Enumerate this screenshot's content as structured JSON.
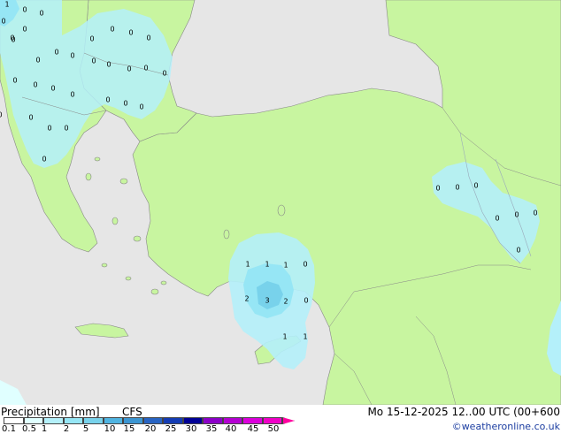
{
  "footer": {
    "title": "Precipitation [mm]",
    "model": "CFS",
    "datetime": "Mo 15-12-2025 12..00 UTC (00+600",
    "credit": "©weatheronline.co.uk"
  },
  "legend": {
    "ticks": [
      "0.1",
      "0.5",
      "1",
      "2",
      "5",
      "10",
      "15",
      "20",
      "25",
      "30",
      "35",
      "40",
      "45",
      "50"
    ],
    "colors": [
      "#ffffff",
      "#e0ffff",
      "#b4f0fa",
      "#96e6f5",
      "#78d2eb",
      "#50b4e1",
      "#3c96d2",
      "#2864c3",
      "#143cb4",
      "#000096",
      "#8c00c8",
      "#b400d2",
      "#dc00dc",
      "#f000c8",
      "#ff00a0"
    ]
  },
  "colors": {
    "sea": "#e6e6e6",
    "land": "#c8f5a0",
    "precip_light": "#b4f0fa",
    "precip_mid": "#96e6f5",
    "precip_dark": "#78d2eb"
  },
  "map_labels": [
    {
      "text": "1"
    },
    {
      "text": "0"
    },
    {
      "text": "0"
    },
    {
      "text": "0"
    },
    {
      "text": "0"
    },
    {
      "text": "0"
    },
    {
      "text": "0"
    },
    {
      "text": "0"
    },
    {
      "text": "0"
    },
    {
      "text": "0"
    },
    {
      "text": "0"
    },
    {
      "text": "0"
    },
    {
      "text": "0"
    },
    {
      "text": "0"
    },
    {
      "text": "0"
    },
    {
      "text": "0"
    },
    {
      "text": "0"
    },
    {
      "text": "0"
    },
    {
      "text": "0"
    },
    {
      "text": "0"
    },
    {
      "text": "0"
    },
    {
      "text": "0"
    },
    {
      "text": "0"
    },
    {
      "text": "0"
    },
    {
      "text": "0"
    },
    {
      "text": "0"
    },
    {
      "text": "0"
    },
    {
      "text": "0"
    },
    {
      "text": "0"
    },
    {
      "text": "0"
    },
    {
      "text": "0"
    },
    {
      "text": "0"
    },
    {
      "text": "0"
    },
    {
      "text": "0"
    },
    {
      "text": "0"
    },
    {
      "text": "0"
    },
    {
      "text": "0"
    },
    {
      "text": "0"
    },
    {
      "text": "1"
    },
    {
      "text": "1"
    },
    {
      "text": "1"
    },
    {
      "text": "0"
    },
    {
      "text": "2"
    },
    {
      "text": "3"
    },
    {
      "text": "2"
    },
    {
      "text": "0"
    },
    {
      "text": "1"
    },
    {
      "text": "1"
    }
  ]
}
